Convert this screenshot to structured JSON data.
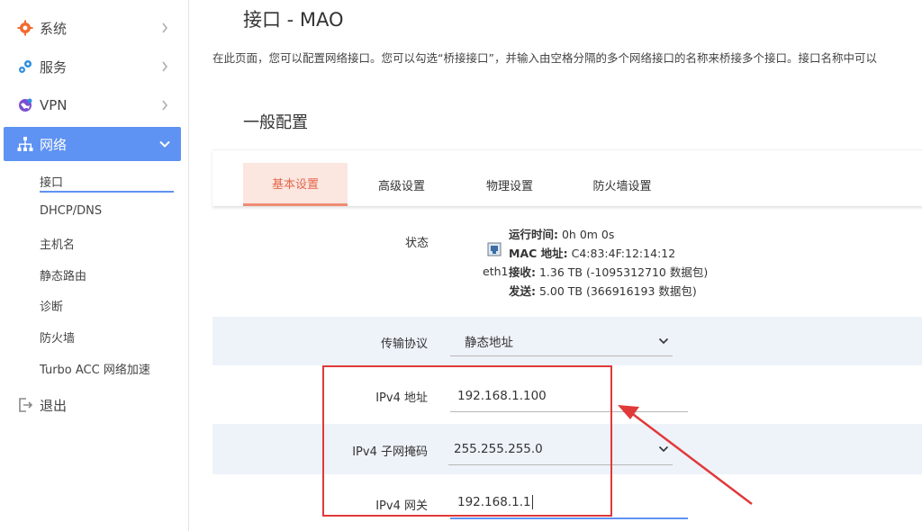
{
  "sidebar": {
    "menu": [
      {
        "label": "系统",
        "icon": "gear-icon"
      },
      {
        "label": "服务",
        "icon": "services-icon"
      },
      {
        "label": "VPN",
        "icon": "vpn-globe-icon"
      },
      {
        "label": "网络",
        "icon": "network-icon",
        "active": true
      },
      {
        "label": "退出",
        "icon": "logout-icon"
      }
    ],
    "network_submenu": [
      "接口",
      "DHCP/DNS",
      "主机名",
      "静态路由",
      "诊断",
      "防火墙",
      "Turbo ACC 网络加速"
    ]
  },
  "page": {
    "title": "接口 - MAO",
    "description": "在此页面，您可以配置网络接口。您可以勾选“桥接接口”，并输入由空格分隔的多个网络接口的名称来桥接多个接口。接口名称中可以",
    "section_title": "一般配置"
  },
  "tabs": [
    "基本设置",
    "高级设置",
    "物理设置",
    "防火墙设置"
  ],
  "status": {
    "label": "状态",
    "device": "eth1",
    "uptime_label": "运行时间:",
    "uptime_value": "0h 0m 0s",
    "mac_label": "MAC 地址:",
    "mac_value": "C4:83:4F:12:14:12",
    "rx_label": "接收:",
    "rx_value": "1.36 TB (-1095312710 数据包)",
    "tx_label": "发送:",
    "tx_value": "5.00 TB (366916193 数据包)"
  },
  "fields": {
    "protocol": {
      "label": "传输协议",
      "value": "静态地址"
    },
    "ipv4_address": {
      "label": "IPv4 地址",
      "value": "192.168.1.100"
    },
    "netmask": {
      "label": "IPv4 子网掩码",
      "value": "255.255.255.0"
    },
    "gateway": {
      "label": "IPv4 网关",
      "value": "192.168.1.1"
    }
  },
  "colors": {
    "accent_blue": "#5e92f3",
    "tab_active": "#e4674c",
    "annotation_red": "#e0393a",
    "shaded_row": "#eef2f9"
  }
}
